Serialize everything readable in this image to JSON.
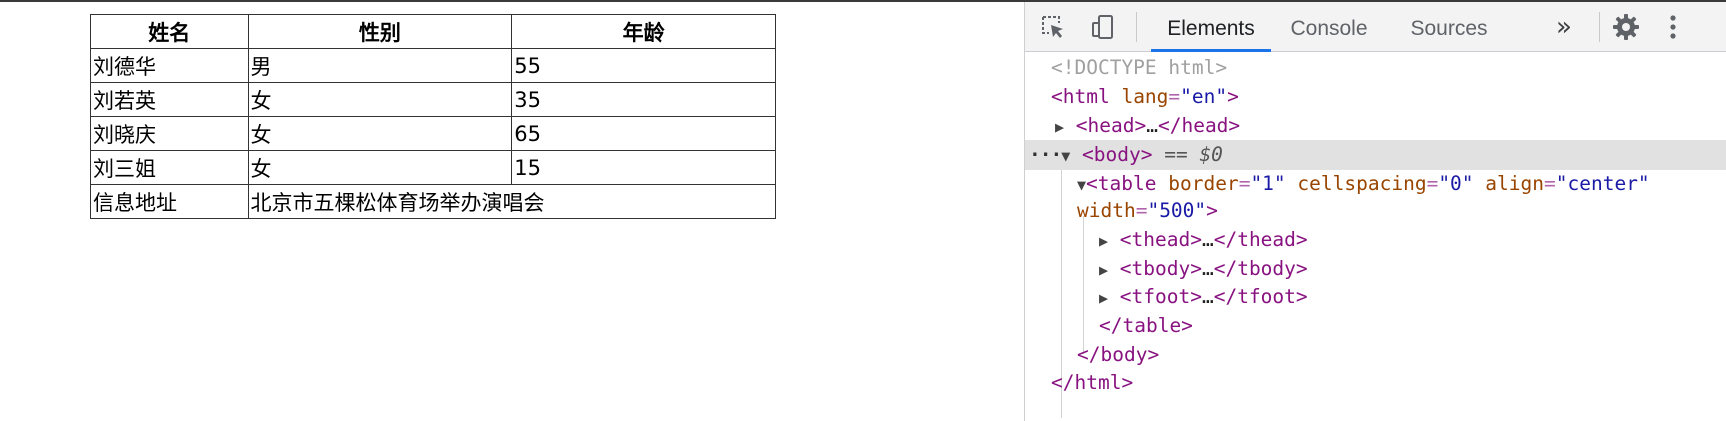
{
  "table": {
    "headers": [
      "姓名",
      "性别",
      "年龄"
    ],
    "rows": [
      [
        "刘德华",
        "男",
        "55"
      ],
      [
        "刘若英",
        "女",
        "35"
      ],
      [
        "刘晓庆",
        "女",
        "65"
      ],
      [
        "刘三姐",
        "女",
        "15"
      ]
    ],
    "footer": {
      "label": "信息地址",
      "value": "北京市五棵松体育场举办演唱会"
    }
  },
  "devtools": {
    "tabs": [
      "Elements",
      "Console",
      "Sources"
    ],
    "active_tab": "Elements",
    "more_tabs": "»",
    "icons": [
      "inspect-element-icon",
      "device-toolbar-icon",
      "gear-icon",
      "kebab-menu-icon"
    ],
    "accent_color": "#1a73e8",
    "dom": {
      "doctype": "<!DOCTYPE html>",
      "html_open": "<html",
      "html_lang_attr": "lang",
      "html_lang_val": "\"en\"",
      "head_open": "<head>",
      "head_close": "</head>",
      "ellipsis": "…",
      "body_open": "<body>",
      "selected_marker": "== $0",
      "table_open": "<table",
      "attr_border": "border",
      "attr_border_val": "\"1\"",
      "attr_cellspacing": "cellspacing",
      "attr_cellspacing_val": "\"0\"",
      "attr_align": "align",
      "attr_align_val": "\"center\"",
      "attr_width": "width",
      "attr_width_val": "\"500\"",
      "thead_open": "<thead>",
      "thead_close": "</thead>",
      "tbody_open": "<tbody>",
      "tbody_close": "</tbody>",
      "tfoot_open": "<tfoot>",
      "tfoot_close": "</tfoot>",
      "table_close": "</table>",
      "body_close": "</body>",
      "html_close": "</html>"
    }
  }
}
